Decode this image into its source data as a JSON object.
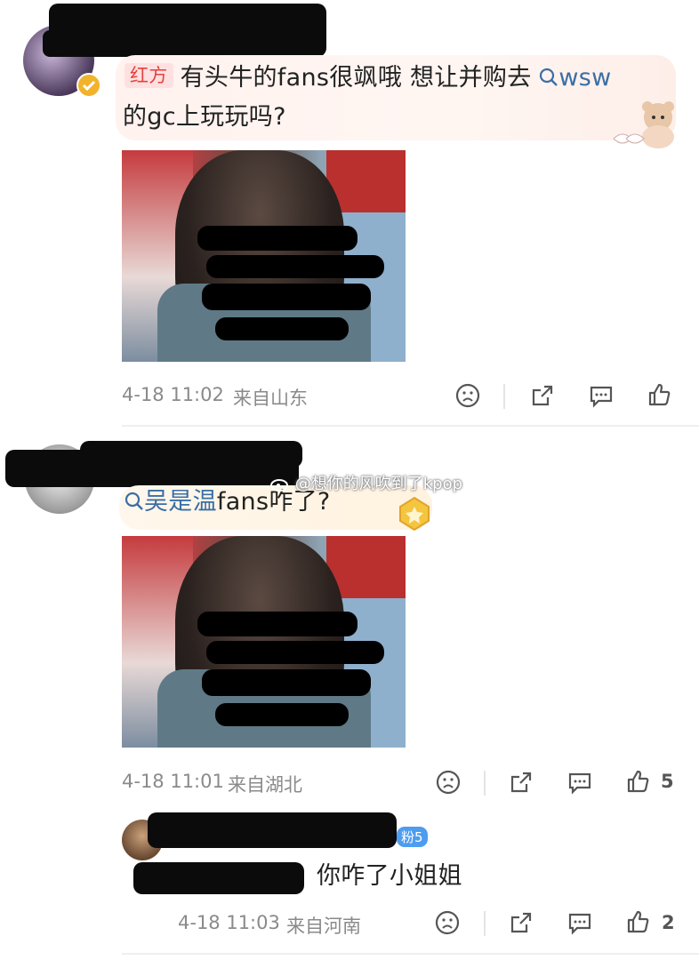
{
  "comments": [
    {
      "tag": "红方",
      "text_1": "有头牛的fans很飒哦 想让并购去",
      "search_term": "wsw",
      "text_2": "的gc上玩玩吗?",
      "time": "4-18 11:02",
      "location": "来自山东",
      "likes": ""
    },
    {
      "search_term": "吴是温",
      "text": "fans咋了?",
      "time": "4-18 11:01",
      "location": "来自湖北",
      "likes": "5"
    }
  ],
  "reply": {
    "fan_badge": "粉5",
    "text": "你咋了小姐姐",
    "time": "4-18 11:03",
    "location": "来自河南",
    "likes": "2"
  },
  "watermark": "@想你的风吹到了kpop",
  "icons": [
    "search-icon",
    "dislike-icon",
    "share-icon",
    "comment-icon",
    "like-icon",
    "verified-icon"
  ],
  "colors": {
    "tag_red": "#e0433f",
    "link_blue": "#3b6ea5",
    "verified": "#f2b32c"
  }
}
